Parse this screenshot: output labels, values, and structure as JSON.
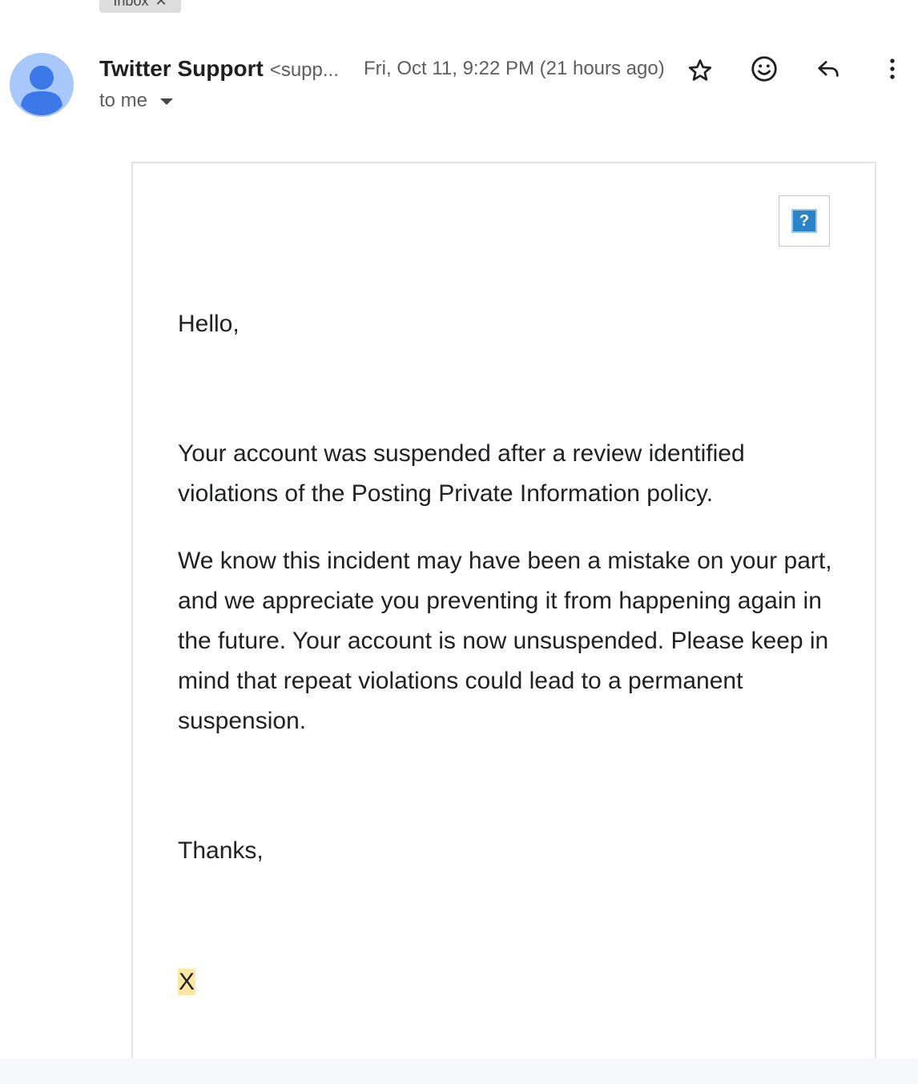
{
  "label_chip": {
    "text": "Inbox",
    "remove_glyph": "✕"
  },
  "sender": {
    "name": "Twitter Support",
    "email": "<supp..."
  },
  "date": "Fri, Oct 11, 9:22 PM (21 hours ago)",
  "recipient": "to me",
  "actions": {
    "star_icon": "star-icon",
    "emoji_icon": "emoji-icon",
    "reply_icon": "reply-icon",
    "more_icon": "more-vert-icon"
  },
  "message": {
    "image_placeholder": "?",
    "greeting": "Hello,",
    "paragraph1": "Your account was suspended after a review identified violations of the Posting Private Information policy.",
    "paragraph2": "We know this incident may have been a mistake on your part, and we appreciate you preventing it from happening again in the future. Your account is now unsuspended.  Please keep in mind that repeat violations could lead to a permanent suspension.",
    "closing": "Thanks,",
    "signature": "X"
  },
  "colors": {
    "avatar_bg": "#a8c7fa",
    "avatar_fg": "#3c78e8",
    "highlight": "#fce8a6"
  }
}
